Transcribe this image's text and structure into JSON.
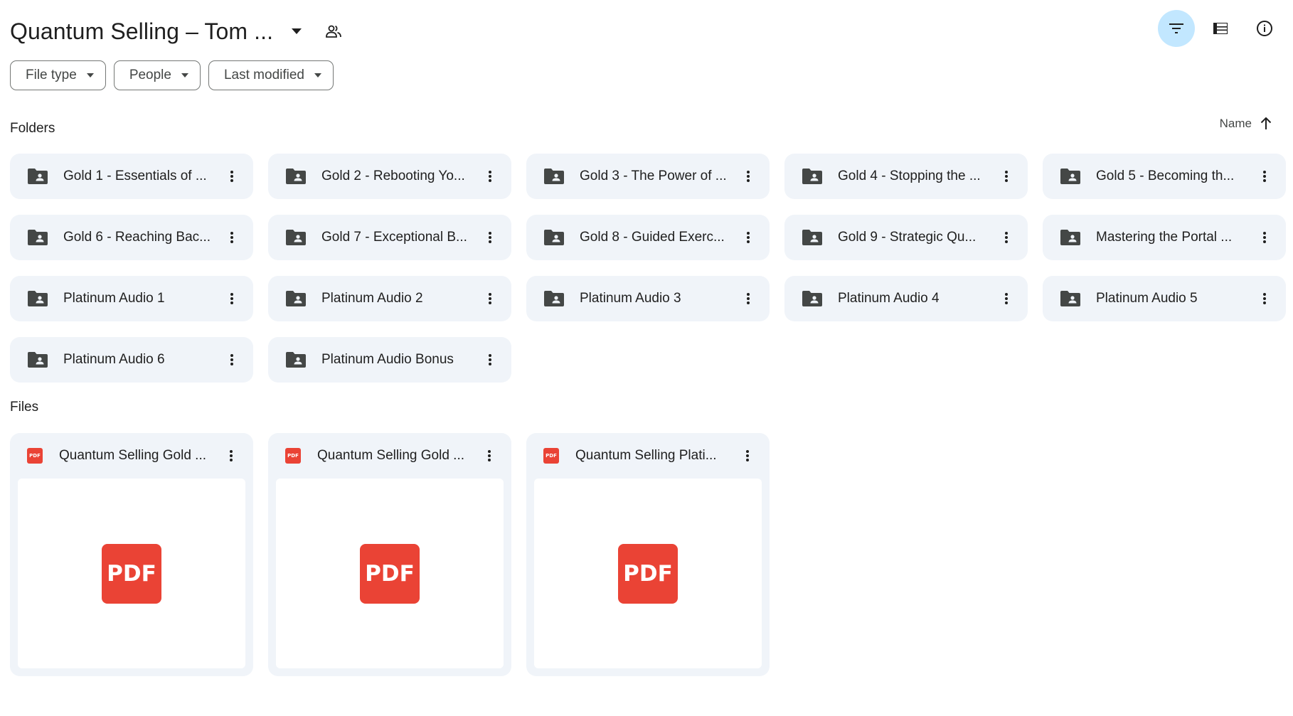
{
  "header": {
    "title": "Quantum Selling – Tom ...",
    "icons": [
      "arrow-drop-down-icon",
      "shared-people-icon",
      "filter-icon",
      "list-view-icon",
      "info-icon"
    ]
  },
  "filters": [
    {
      "label": "File type"
    },
    {
      "label": "People"
    },
    {
      "label": "Last modified"
    }
  ],
  "folders_section": {
    "label": "Folders",
    "sort_label": "Name",
    "sort_direction": "ascending"
  },
  "folders": [
    {
      "name": "Gold 1 - Essentials of ..."
    },
    {
      "name": "Gold 2 - Rebooting Yo..."
    },
    {
      "name": "Gold 3 - The Power of ..."
    },
    {
      "name": "Gold 4 - Stopping the ..."
    },
    {
      "name": "Gold 5 - Becoming th..."
    },
    {
      "name": "Gold 6 - Reaching Bac..."
    },
    {
      "name": "Gold 7 - Exceptional B..."
    },
    {
      "name": "Gold 8 - Guided Exerc..."
    },
    {
      "name": "Gold 9 - Strategic Qu..."
    },
    {
      "name": "Mastering the Portal ..."
    },
    {
      "name": "Platinum Audio 1"
    },
    {
      "name": "Platinum Audio 2"
    },
    {
      "name": "Platinum Audio 3"
    },
    {
      "name": "Platinum Audio 4"
    },
    {
      "name": "Platinum Audio 5"
    },
    {
      "name": "Platinum Audio 6"
    },
    {
      "name": "Platinum Audio Bonus"
    }
  ],
  "files_section": {
    "label": "Files"
  },
  "files": [
    {
      "name": "Quantum Selling Gold ...",
      "type_badge": "PDF",
      "thumb_label": "PDF"
    },
    {
      "name": "Quantum Selling Gold ...",
      "type_badge": "PDF",
      "thumb_label": "PDF"
    },
    {
      "name": "Quantum Selling Plati...",
      "type_badge": "PDF",
      "thumb_label": "PDF"
    }
  ],
  "colors": {
    "accent_active": "#c2e7ff",
    "card_bg": "#f0f4f9",
    "pdf_red": "#ea4335",
    "text": "#1f1f1f"
  }
}
